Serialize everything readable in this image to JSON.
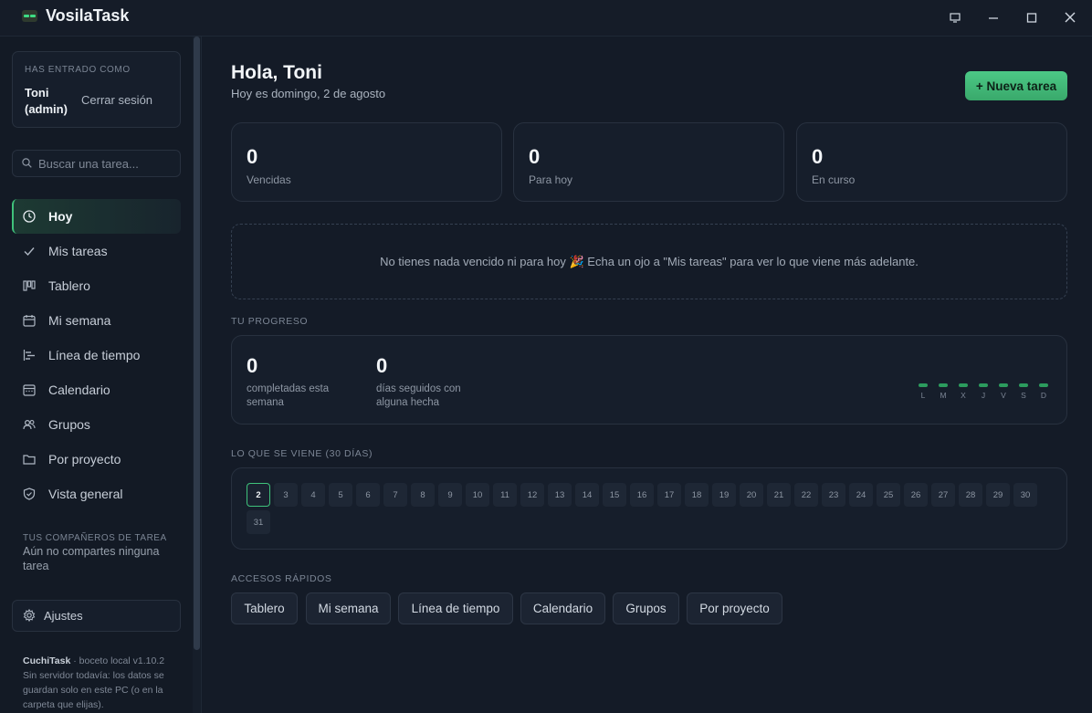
{
  "app": {
    "title": "VosilaTask"
  },
  "user": {
    "caption": "HAS ENTRADO COMO",
    "name": "Toni (admin)",
    "logout": "Cerrar sesión"
  },
  "search": {
    "placeholder": "Buscar una tarea..."
  },
  "nav": [
    {
      "label": "Hoy",
      "icon": "clock-icon",
      "active": true
    },
    {
      "label": "Mis tareas",
      "icon": "check-icon"
    },
    {
      "label": "Tablero",
      "icon": "board-icon"
    },
    {
      "label": "Mi semana",
      "icon": "calendar-week-icon"
    },
    {
      "label": "Línea de tiempo",
      "icon": "timeline-icon"
    },
    {
      "label": "Calendario",
      "icon": "calendar-icon"
    },
    {
      "label": "Grupos",
      "icon": "users-icon"
    },
    {
      "label": "Por proyecto",
      "icon": "folder-icon"
    },
    {
      "label": "Vista general",
      "icon": "shield-icon"
    }
  ],
  "teammates": {
    "caption": "TUS COMPAÑEROS DE TAREA",
    "text": "Aún no compartes ninguna tarea"
  },
  "settings": {
    "label": "Ajustes"
  },
  "footer": {
    "brand": "CuchiTask",
    "version": " · boceto local v1.10.2",
    "note": "Sin servidor todavía: los datos se guardan solo en este PC (o en la carpeta que elijas)."
  },
  "header": {
    "greeting": "Hola, Toni",
    "date": "Hoy es domingo, 2 de agosto",
    "new_task": "+ Nueva tarea"
  },
  "stats": [
    {
      "value": "0",
      "label": "Vencidas"
    },
    {
      "value": "0",
      "label": "Para hoy"
    },
    {
      "value": "0",
      "label": "En curso"
    }
  ],
  "empty_message": "No tienes nada vencido ni para hoy 🎉 Echa un ojo a \"Mis tareas\" para ver lo que viene más adelante.",
  "progress": {
    "caption": "TU PROGRESO",
    "completed_value": "0",
    "completed_label": "completadas esta semana",
    "streak_value": "0",
    "streak_label": "días seguidos con alguna hecha",
    "week_days": [
      "L",
      "M",
      "X",
      "J",
      "V",
      "S",
      "D"
    ],
    "week_counts": [
      0,
      0,
      0,
      0,
      0,
      0,
      0
    ]
  },
  "upcoming": {
    "caption": "LO QUE SE VIENE (30 DÍAS)",
    "today": "2",
    "days": [
      "2",
      "3",
      "4",
      "5",
      "6",
      "7",
      "8",
      "9",
      "10",
      "11",
      "12",
      "13",
      "14",
      "15",
      "16",
      "17",
      "18",
      "19",
      "20",
      "21",
      "22",
      "23",
      "24",
      "25",
      "26",
      "27",
      "28",
      "29",
      "30",
      "31"
    ]
  },
  "quick_access": {
    "caption": "ACCESOS RÁPIDOS",
    "items": [
      "Tablero",
      "Mi semana",
      "Línea de tiempo",
      "Calendario",
      "Grupos",
      "Por proyecto"
    ]
  },
  "colors": {
    "accent": "#3fc27b",
    "background": "#141b27",
    "card": "#161e2b"
  }
}
